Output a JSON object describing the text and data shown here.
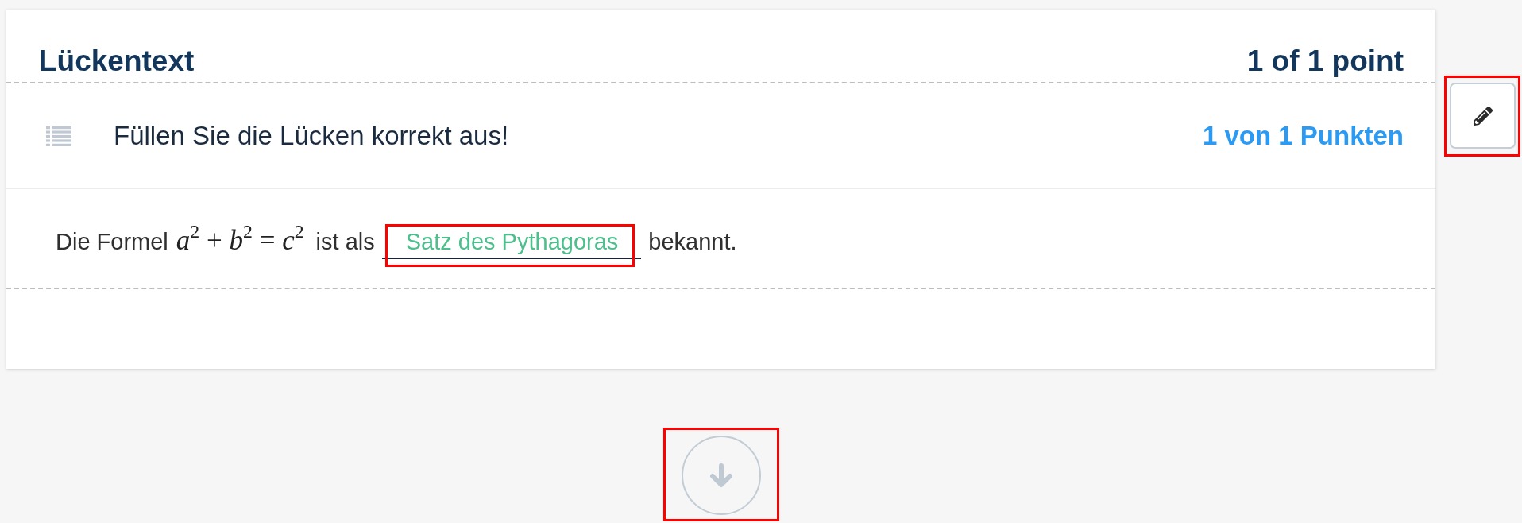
{
  "question": {
    "title": "Lückentext",
    "score": "1 of 1 point",
    "task": {
      "instruction": "Füllen Sie die Lücken korrekt aus!",
      "points": "1 von 1 Punkten"
    },
    "sentence": [
      {
        "kind": "text",
        "text": "Die Formel"
      },
      {
        "kind": "math",
        "text": "*a*$^{2}$ + *b*$^{2}$ = *c*$^{2}$"
      },
      {
        "kind": "text",
        "text": "ist als"
      },
      {
        "kind": "blank",
        "value": "Satz des Pythagoras",
        "correct": true,
        "highlighted": true
      },
      {
        "kind": "text",
        "text": "bekannt."
      }
    ]
  },
  "edit_button": {
    "highlighted": true
  },
  "scroll_down_button": {
    "highlighted": true
  }
}
